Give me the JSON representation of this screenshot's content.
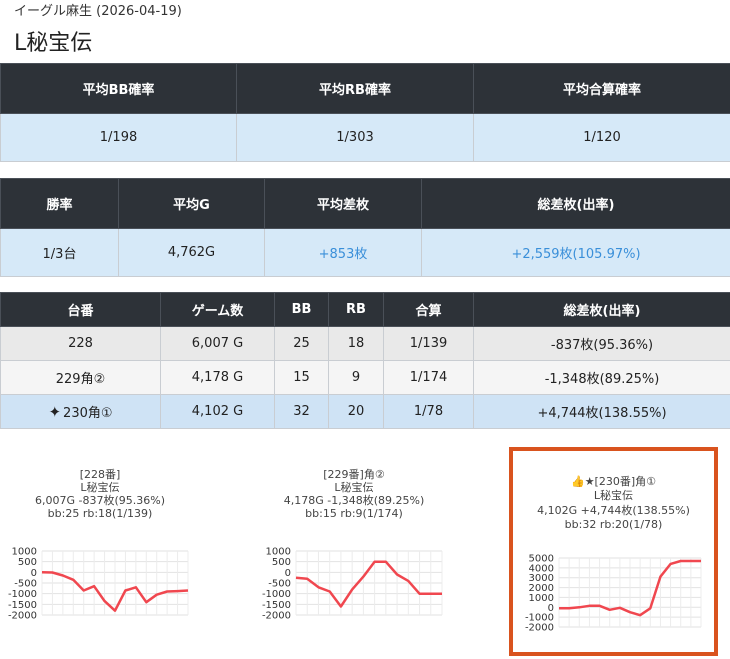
{
  "page": {
    "subtitle": "イーグル麻生 (2026-04-19)",
    "title": "L秘宝伝"
  },
  "table1": {
    "headers": [
      "平均BB確率",
      "平均RB確率",
      "平均合算確率"
    ],
    "values": [
      "1/198",
      "1/303",
      "1/120"
    ]
  },
  "table2": {
    "headers": [
      "勝率",
      "平均G",
      "平均差枚",
      "総差枚(出率)"
    ],
    "values": [
      "1/3台",
      "4,762G",
      "+853枚",
      "+2,559枚(105.97%)"
    ]
  },
  "table3": {
    "headers": [
      "台番",
      "ゲーム数",
      "BB",
      "RB",
      "合算",
      "総差枚(出率)"
    ],
    "rows": [
      {
        "num": "228",
        "games": "6,007 G",
        "bb": "25",
        "rb": "18",
        "total": "1/139",
        "diff": "-837枚(95.36%)"
      },
      {
        "num": "229角②",
        "games": "4,178 G",
        "bb": "15",
        "rb": "9",
        "total": "1/174",
        "diff": "-1,348枚(89.25%)"
      },
      {
        "num": "230角①",
        "games": "4,102 G",
        "bb": "32",
        "rb": "20",
        "total": "1/78",
        "diff": "+4,744枚(138.55%)",
        "icon": "sparkle-icon"
      }
    ]
  },
  "cards": [
    {
      "line1": "[228番]",
      "line2": "L秘宝伝",
      "line3": "6,007G -837枚(95.36%)",
      "line4": "bb:25 rb:18(1/139)"
    },
    {
      "line1": "[229番]角②",
      "line2": "L秘宝伝",
      "line3": "4,178G -1,348枚(89.25%)",
      "line4": "bb:15 rb:9(1/174)"
    },
    {
      "line1": "👍★[230番]角①",
      "line2": "L秘宝伝",
      "line3": "4,102G +4,744枚(138.55%)",
      "line4": "bb:32 rb:20(1/78)"
    }
  ],
  "chart_data": [
    {
      "type": "line",
      "ylim": [
        -2000,
        1000
      ],
      "yticks": [
        "1000",
        "500",
        "0",
        "-500",
        "-1000",
        "-1500",
        "-2000"
      ],
      "line_color": "#f0474f",
      "values": [
        0,
        -10,
        -150,
        -350,
        -850,
        -650,
        -1350,
        -1800,
        -850,
        -700,
        -1400,
        -1050,
        -900,
        -880,
        -850
      ]
    },
    {
      "type": "line",
      "ylim": [
        -2000,
        1000
      ],
      "yticks": [
        "1000",
        "500",
        "0",
        "-500",
        "-1000",
        "-1500",
        "-2000"
      ],
      "line_color": "#f0474f",
      "values": [
        -250,
        -300,
        -700,
        -900,
        -1600,
        -800,
        -200,
        500,
        500,
        -100,
        -400,
        -1000,
        -1000,
        -1000
      ]
    },
    {
      "type": "line",
      "ylim": [
        -2000,
        5000
      ],
      "yticks": [
        "5000",
        "4000",
        "3000",
        "2000",
        "1000",
        "0",
        "-1000",
        "-2000"
      ],
      "line_color": "#f0474f",
      "values": [
        -100,
        -100,
        0,
        150,
        150,
        -250,
        -50,
        -500,
        -800,
        -100,
        3100,
        4400,
        4700,
        4700,
        4700
      ]
    }
  ]
}
